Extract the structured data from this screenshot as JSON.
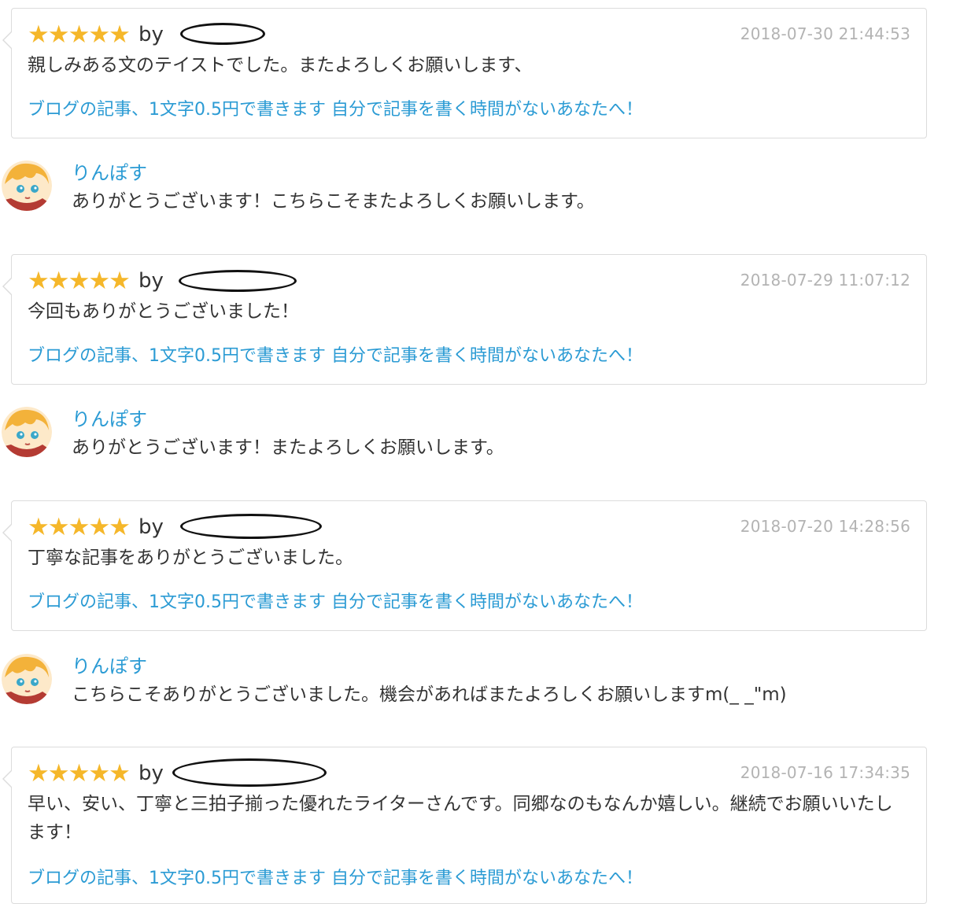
{
  "reviews": [
    {
      "stars": "★★★★★",
      "by": "by",
      "timestamp": "2018-07-30 21:44:53",
      "comment": "親しみある文のテイストでした。またよろしくお願いします、",
      "service_link": "ブログの記事、1文字0.5円で書きます 自分で記事を書く時間がないあなたへ！",
      "reply": {
        "name": "りんぽす",
        "text": "ありがとうございます！こちらこそまたよろしくお願いします。"
      }
    },
    {
      "stars": "★★★★★",
      "by": "by",
      "timestamp": "2018-07-29 11:07:12",
      "comment": "今回もありがとうございました！",
      "service_link": "ブログの記事、1文字0.5円で書きます 自分で記事を書く時間がないあなたへ！",
      "reply": {
        "name": "りんぽす",
        "text": "ありがとうございます！またよろしくお願いします。"
      }
    },
    {
      "stars": "★★★★★",
      "by": "by",
      "timestamp": "2018-07-20 14:28:56",
      "comment": "丁寧な記事をありがとうございました。",
      "service_link": "ブログの記事、1文字0.5円で書きます 自分で記事を書く時間がないあなたへ！",
      "reply": {
        "name": "りんぽす",
        "text": "こちらこそありがとうございました。機会があればまたよろしくお願いしますm(_ _\"m)"
      }
    },
    {
      "stars": "★★★★★",
      "by": "by",
      "timestamp": "2018-07-16 17:34:35",
      "comment": "早い、安い、丁寧と三拍子揃った優れたライターさんです。同郷なのもなんか嬉しい。継続でお願いいたします！",
      "service_link": "ブログの記事、1文字0.5円で書きます 自分で記事を書く時間がないあなたへ！"
    }
  ],
  "colors": {
    "star": "#f5b72a",
    "link": "#2b9bd4",
    "timestamp": "#b3b3b3",
    "text": "#333333",
    "card_border": "#dcdcdc"
  },
  "icons": {
    "star": "star-icon",
    "avatar": "seller-avatar"
  }
}
